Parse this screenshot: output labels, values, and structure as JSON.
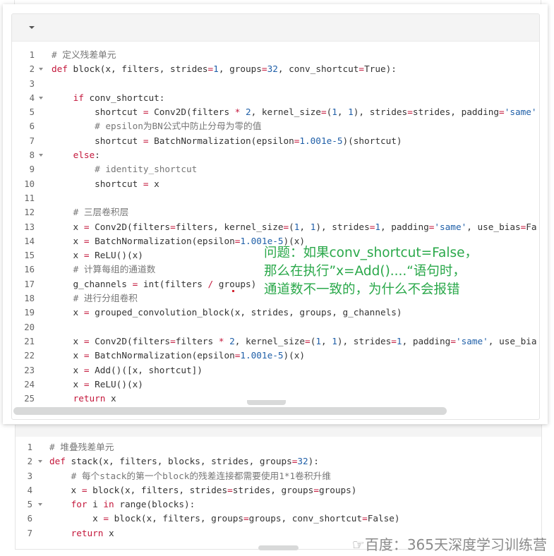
{
  "top_snippet": {
    "lines": [
      {
        "n": "1",
        "fold": false,
        "html": "<span class=\"cm\"># 定义残差单元</span>"
      },
      {
        "n": "2",
        "fold": true,
        "html": "<span class=\"kw\">def</span> block(x, filters, strides<span class=\"op\">=</span><span class=\"num\">1</span>, groups<span class=\"op\">=</span><span class=\"num\">32</span>, conv_shortcut<span class=\"op\">=</span>True):"
      },
      {
        "n": "3",
        "fold": false,
        "html": ""
      },
      {
        "n": "4",
        "fold": true,
        "html": "    <span class=\"kw\">if</span> conv_shortcut:"
      },
      {
        "n": "5",
        "fold": false,
        "html": "        shortcut <span class=\"op\">=</span> Conv2D(filters <span class=\"op\">*</span> <span class=\"num\">2</span>, kernel_size<span class=\"op\">=</span>(<span class=\"num\">1</span>, <span class=\"num\">1</span>), strides<span class=\"op\">=</span>strides, padding<span class=\"op\">=</span><span class=\"str\">'same'</span>"
      },
      {
        "n": "6",
        "fold": false,
        "html": "        <span class=\"cm\"># epsilon为BN公式中防止分母为零的值</span>"
      },
      {
        "n": "7",
        "fold": false,
        "html": "        shortcut <span class=\"op\">=</span> BatchNormalization(epsilon<span class=\"op\">=</span><span class=\"num\">1.001e-5</span>)(shortcut)"
      },
      {
        "n": "8",
        "fold": true,
        "html": "    <span class=\"kw\">else</span>:"
      },
      {
        "n": "9",
        "fold": false,
        "html": "        <span class=\"cm\"># identity_shortcut</span>"
      },
      {
        "n": "10",
        "fold": false,
        "html": "        shortcut <span class=\"op\">=</span> x"
      },
      {
        "n": "11",
        "fold": false,
        "html": ""
      },
      {
        "n": "12",
        "fold": false,
        "html": "    <span class=\"cm\"># 三层卷积层</span>"
      },
      {
        "n": "13",
        "fold": false,
        "html": "    x <span class=\"op\">=</span> Conv2D(filters<span class=\"op\">=</span>filters, kernel_size<span class=\"op\">=</span>(<span class=\"num\">1</span>, <span class=\"num\">1</span>), strides<span class=\"op\">=</span><span class=\"num\">1</span>, padding<span class=\"op\">=</span><span class=\"str\">'same'</span>, use_bias<span class=\"op\">=</span>Fa"
      },
      {
        "n": "14",
        "fold": false,
        "html": "    x <span class=\"op\">=</span> BatchNormalization(epsilon<span class=\"op\">=</span><span class=\"num\">1.001e-5</span>)(x)"
      },
      {
        "n": "15",
        "fold": false,
        "html": "    x <span class=\"op\">=</span> ReLU()(x)"
      },
      {
        "n": "16",
        "fold": false,
        "html": "    <span class=\"cm\"># 计算每组的通道数</span>"
      },
      {
        "n": "17",
        "fold": false,
        "html": "    g_channels <span class=\"op\">=</span> int(filters <span class=\"op\">/</span> groups)"
      },
      {
        "n": "18",
        "fold": false,
        "html": "    <span class=\"cm\"># 进行分组卷积</span>"
      },
      {
        "n": "19",
        "fold": false,
        "html": "    x <span class=\"op\">=</span> grouped_convolution_block(x, strides, groups, g_channels)"
      },
      {
        "n": "20",
        "fold": false,
        "html": ""
      },
      {
        "n": "21",
        "fold": false,
        "html": "    x <span class=\"op\">=</span> Conv2D(filters<span class=\"op\">=</span>filters <span class=\"op\">*</span> <span class=\"num\">2</span>, kernel_size<span class=\"op\">=</span>(<span class=\"num\">1</span>, <span class=\"num\">1</span>), strides<span class=\"op\">=</span><span class=\"num\">1</span>, padding<span class=\"op\">=</span><span class=\"str\">'same'</span>, use_bia"
      },
      {
        "n": "22",
        "fold": false,
        "html": "    x <span class=\"op\">=</span> BatchNormalization(epsilon<span class=\"op\">=</span><span class=\"num\">1.001e-5</span>)(x)"
      },
      {
        "n": "23",
        "fold": false,
        "html": "    x <span class=\"op\">=</span> Add()([x, shortcut])"
      },
      {
        "n": "24",
        "fold": false,
        "html": "    x <span class=\"op\">=</span> ReLU()(x)"
      },
      {
        "n": "25",
        "fold": false,
        "html": "    <span class=\"kw\">return</span> x"
      }
    ]
  },
  "annotation": {
    "text": "问题：如果conv_shortcut=False，\n那么在执行”x=Add()....“语句时，\n通道数不一致的，为什么不会报错",
    "color": "#2aa84a"
  },
  "bottom_snippet": {
    "lines": [
      {
        "n": "1",
        "fold": false,
        "html": "<span class=\"cm\"># 堆叠残差单元</span>"
      },
      {
        "n": "2",
        "fold": true,
        "html": "<span class=\"kw\">def</span> stack(x, filters, blocks, strides, groups<span class=\"op\">=</span><span class=\"num\">32</span>):"
      },
      {
        "n": "3",
        "fold": false,
        "html": "    <span class=\"cm\"># 每个stack的第一个block的残差连接都需要使用1*1卷积升维</span>"
      },
      {
        "n": "4",
        "fold": false,
        "html": "    x <span class=\"op\">=</span> block(x, filters, strides<span class=\"op\">=</span>strides, groups<span class=\"op\">=</span>groups)"
      },
      {
        "n": "5",
        "fold": true,
        "html": "    <span class=\"kw\">for</span> i <span class=\"kw\">in</span> range(blocks):"
      },
      {
        "n": "6",
        "fold": false,
        "html": "        x <span class=\"op\">=</span> block(x, filters, groups<span class=\"op\">=</span>groups, conv_shortcut<span class=\"op\">=</span>False)"
      },
      {
        "n": "7",
        "fold": false,
        "html": "    <span class=\"kw\">return</span> x"
      }
    ]
  },
  "watermark": "☞百度：365天深度学习训练营",
  "colors": {
    "highlight_box": "#d32936",
    "keyword": "#c4183c",
    "number": "#1f5fa8"
  }
}
